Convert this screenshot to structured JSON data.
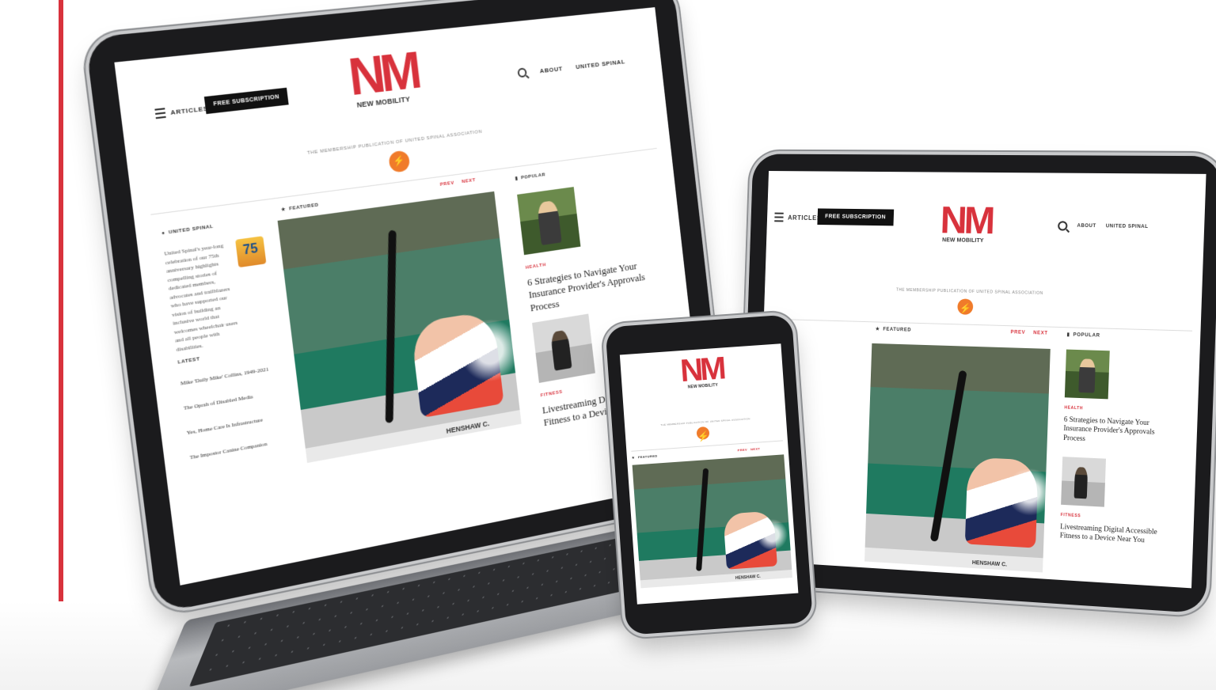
{
  "site": {
    "logo_mark": "NM",
    "logo_name": "NEW MOBILITY",
    "tagline": "THE MEMBERSHIP PUBLICATION OF UNITED SPINAL ASSOCIATION",
    "menu_label": "ARTICLES",
    "subscribe_label": "FREE SUBSCRIPTION",
    "nav": [
      "ABOUT",
      "UNITED SPINAL"
    ],
    "search_icon": "search-icon",
    "badge_icon": "lightning-badge-icon"
  },
  "sections": {
    "united_spinal": "UNITED SPINAL",
    "featured": "FEATURED",
    "popular": "POPULAR",
    "latest": "LATEST",
    "prev": "PREV",
    "next": "NEXT"
  },
  "sidebar": {
    "blurb": "United Spinal's year-long celebration of our 75th anniversary highlights compelling stories of dedicated members, advocates and trailblazers who have supported our vision of building an inclusive world that welcomes wheelchair users and all people with disabilities.",
    "seal_text": "75",
    "latest": [
      "Mike 'Daily Mike' Collins, 1949-2021",
      "The Oprah of Disabled Media",
      "Yes, Home Care Is Infrastructure",
      "The Impostor Canine Companion"
    ]
  },
  "featured": {
    "photo_caption": "HENSHAW C.",
    "photo_desc": "Para-canoe athlete paddling"
  },
  "popular": [
    {
      "category": "HEALTH",
      "title": "6 Strategies to Navigate Your Insurance Provider's Approvals Process"
    },
    {
      "category": "FITNESS",
      "title": "Livestreaming Digital Accessible Fitness to a Device Near You"
    }
  ],
  "colors": {
    "brand_red": "#d8323c",
    "badge_orange": "#f07b2a",
    "dark": "#111111"
  }
}
